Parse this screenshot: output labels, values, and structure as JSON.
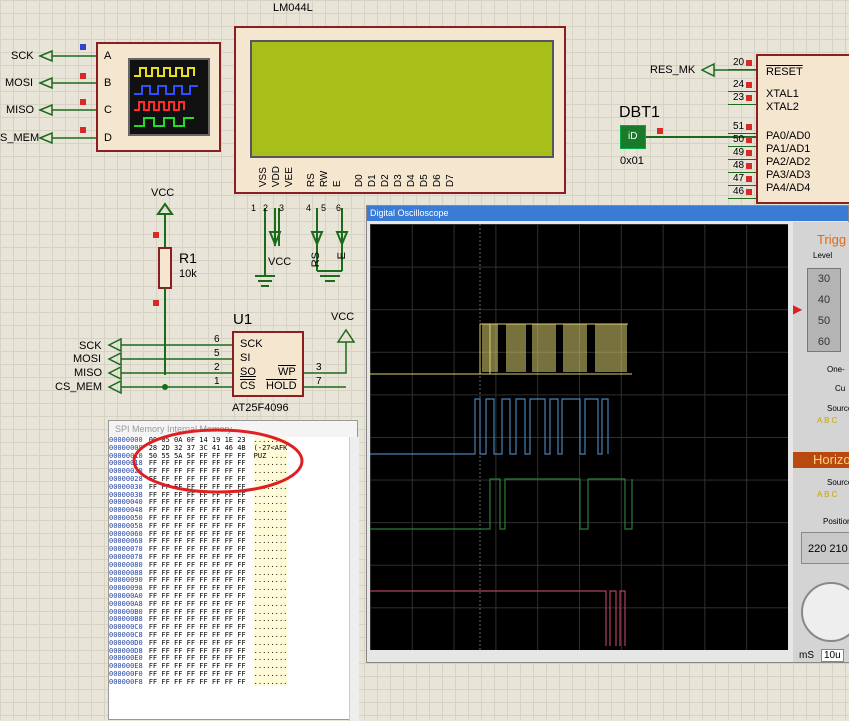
{
  "left_labels": {
    "sck": "SCK",
    "mosi": "MOSI",
    "miso": "MISO",
    "cs_mem": "S_MEM"
  },
  "scope_pins": [
    "A",
    "B",
    "C",
    "D"
  ],
  "lcd": {
    "name": "LM044L",
    "pins": [
      "VSS",
      "VDD",
      "VEE",
      "RS",
      "RW",
      "E",
      "D0",
      "D1",
      "D2",
      "D3",
      "D4",
      "D5",
      "D6",
      "D7"
    ],
    "pin_numbers": [
      "1",
      "2",
      "3",
      "4",
      "5",
      "6"
    ],
    "vcc": "VCC",
    "rs": "RS",
    "e": "E"
  },
  "mcu": {
    "res_label": "RES_MK",
    "pins": [
      {
        "num": "20",
        "name": "RESET"
      },
      {
        "num": "24",
        "name": "XTAL1"
      },
      {
        "num": "23",
        "name": "XTAL2"
      },
      {
        "num": "51",
        "name": "PA0/AD0"
      },
      {
        "num": "50",
        "name": "PA1/AD1"
      },
      {
        "num": "49",
        "name": "PA2/AD2"
      },
      {
        "num": "48",
        "name": "PA3/AD3"
      },
      {
        "num": "47",
        "name": "PA4/AD4"
      },
      {
        "num": "46",
        "name": ""
      }
    ]
  },
  "dbt": {
    "name": "DBT1",
    "icon": "iD",
    "value": "0x01"
  },
  "resistor": {
    "vcc": "VCC",
    "name": "R1",
    "value": "10k"
  },
  "u1": {
    "name": "U1",
    "part": "AT25F4096",
    "pins_left": [
      {
        "num": "6",
        "name": "SCK"
      },
      {
        "num": "5",
        "name": "SI"
      },
      {
        "num": "2",
        "name": "SO"
      },
      {
        "num": "1",
        "name": "CS"
      }
    ],
    "pins_right": [
      {
        "num": "3",
        "name": "WP"
      },
      {
        "num": "7",
        "name": "HOLD"
      }
    ],
    "vcc": "VCC"
  },
  "u1_labels": {
    "sck": "SCK",
    "mosi": "MOSI",
    "miso": "MISO",
    "cs": "CS_MEM"
  },
  "hex": {
    "title": "SPI Memory Internal Memory",
    "rows": [
      {
        "addr": "00000000",
        "bytes": "00 05 0A 0F 14 19 1E 23",
        "ascii": "........"
      },
      {
        "addr": "00000008",
        "bytes": "28 2D 32 37 3C 41 46 4B",
        "ascii": "(-27<AFK"
      },
      {
        "addr": "00000010",
        "bytes": "50 55 5A 5F FF FF FF FF",
        "ascii": "PUZ_...."
      },
      {
        "addr": "00000018",
        "bytes": "FF FF FF FF FF FF FF FF",
        "ascii": "........"
      },
      {
        "addr": "00000020",
        "bytes": "FF FF FF FF FF FF FF FF",
        "ascii": "........"
      },
      {
        "addr": "00000028",
        "bytes": "FF FF FF FF FF FF FF FF",
        "ascii": "........"
      },
      {
        "addr": "00000030",
        "bytes": "FF FF FF FF FF FF FF FF",
        "ascii": "........"
      },
      {
        "addr": "00000038",
        "bytes": "FF FF FF FF FF FF FF FF",
        "ascii": "........"
      },
      {
        "addr": "00000040",
        "bytes": "FF FF FF FF FF FF FF FF",
        "ascii": "........"
      },
      {
        "addr": "00000048",
        "bytes": "FF FF FF FF FF FF FF FF",
        "ascii": "........"
      },
      {
        "addr": "00000050",
        "bytes": "FF FF FF FF FF FF FF FF",
        "ascii": "........"
      },
      {
        "addr": "00000058",
        "bytes": "FF FF FF FF FF FF FF FF",
        "ascii": "........"
      },
      {
        "addr": "00000060",
        "bytes": "FF FF FF FF FF FF FF FF",
        "ascii": "........"
      },
      {
        "addr": "00000068",
        "bytes": "FF FF FF FF FF FF FF FF",
        "ascii": "........"
      },
      {
        "addr": "00000070",
        "bytes": "FF FF FF FF FF FF FF FF",
        "ascii": "........"
      },
      {
        "addr": "00000078",
        "bytes": "FF FF FF FF FF FF FF FF",
        "ascii": "........"
      },
      {
        "addr": "00000080",
        "bytes": "FF FF FF FF FF FF FF FF",
        "ascii": "........"
      },
      {
        "addr": "00000088",
        "bytes": "FF FF FF FF FF FF FF FF",
        "ascii": "........"
      },
      {
        "addr": "00000090",
        "bytes": "FF FF FF FF FF FF FF FF",
        "ascii": "........"
      },
      {
        "addr": "00000098",
        "bytes": "FF FF FF FF FF FF FF FF",
        "ascii": "........"
      },
      {
        "addr": "000000A0",
        "bytes": "FF FF FF FF FF FF FF FF",
        "ascii": "........"
      },
      {
        "addr": "000000A8",
        "bytes": "FF FF FF FF FF FF FF FF",
        "ascii": "........"
      },
      {
        "addr": "000000B0",
        "bytes": "FF FF FF FF FF FF FF FF",
        "ascii": "........"
      },
      {
        "addr": "000000B8",
        "bytes": "FF FF FF FF FF FF FF FF",
        "ascii": "........"
      },
      {
        "addr": "000000C0",
        "bytes": "FF FF FF FF FF FF FF FF",
        "ascii": "........"
      },
      {
        "addr": "000000C8",
        "bytes": "FF FF FF FF FF FF FF FF",
        "ascii": "........"
      },
      {
        "addr": "000000D0",
        "bytes": "FF FF FF FF FF FF FF FF",
        "ascii": "........"
      },
      {
        "addr": "000000D8",
        "bytes": "FF FF FF FF FF FF FF FF",
        "ascii": "........"
      },
      {
        "addr": "000000E0",
        "bytes": "FF FF FF FF FF FF FF FF",
        "ascii": "........"
      },
      {
        "addr": "000000E8",
        "bytes": "FF FF FF FF FF FF FF FF",
        "ascii": "........"
      },
      {
        "addr": "000000F0",
        "bytes": "FF FF FF FF FF FF FF FF",
        "ascii": "........"
      },
      {
        "addr": "000000F8",
        "bytes": "FF FF FF FF FF FF FF FF",
        "ascii": "........"
      }
    ]
  },
  "osc": {
    "title": "Digital Oscilloscope",
    "trigger": "Trigg",
    "level": "Level",
    "level_ticks": [
      "30",
      "40",
      "50",
      "60"
    ],
    "one": "One-",
    "cur": "Cu",
    "source": "Source",
    "source_opts": "A B C",
    "horizontal": "Horizo",
    "position": "Position",
    "pos_value": "220 210",
    "unit": "mS",
    "timebase": "10u"
  },
  "colors": {
    "trace_a": "#d8d070",
    "trace_b": "#4a7fb5",
    "trace_c": "#2e7a3a",
    "trace_d": "#b0405a",
    "lcd": "#a8bf1a",
    "annotation": "#e02020"
  }
}
